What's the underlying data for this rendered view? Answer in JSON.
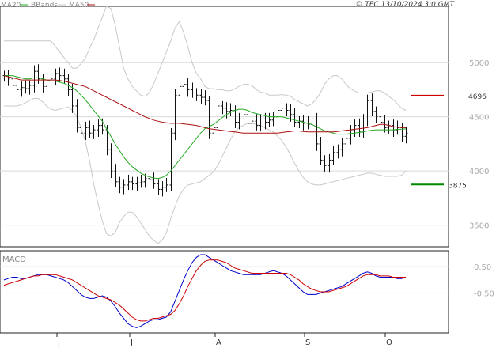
{
  "legend": [
    {
      "label": "MA20",
      "color": "#22aa22"
    },
    {
      "label": "BBands",
      "color": "#c8c8c8"
    },
    {
      "label": "MA50",
      "color": "#aa1111"
    }
  ],
  "copyright": "© TEC 13/10/2024 3:0 GMT",
  "macd_title": "MACD",
  "chart_data": [
    {
      "type": "line",
      "subtype": "bar-ohlc",
      "x_tick_labels": [
        "J",
        "J",
        "A",
        "S",
        "O"
      ],
      "y_tick_labels": [
        "5000",
        "4500",
        "4000",
        "3500"
      ],
      "ylim": [
        3300,
        5520
      ],
      "grid": true,
      "levels": [
        {
          "value": 4696,
          "label": "4696",
          "color": "#cc0000"
        },
        {
          "value": 3875,
          "label": "3875",
          "color": "#008800"
        }
      ],
      "price": [
        4880,
        4850,
        4790,
        4750,
        4770,
        4760,
        4790,
        4920,
        4850,
        4780,
        4830,
        4850,
        4900,
        4880,
        4850,
        4750,
        4600,
        4400,
        4350,
        4400,
        4350,
        4380,
        4420,
        4380,
        4200,
        4000,
        3900,
        3850,
        3870,
        3900,
        3880,
        3890,
        3900,
        3930,
        3920,
        3880,
        3830,
        3850,
        3870,
        4350,
        4700,
        4780,
        4800,
        4750,
        4720,
        4700,
        4680,
        4650,
        4350,
        4400,
        4600,
        4580,
        4550,
        4560,
        4450,
        4480,
        4520,
        4440,
        4460,
        4420,
        4480,
        4450,
        4470,
        4500,
        4560,
        4580,
        4560,
        4520,
        4450,
        4460,
        4440,
        4430,
        4480,
        4250,
        4100,
        4050,
        4100,
        4170,
        4200,
        4250,
        4300,
        4380,
        4420,
        4360,
        4480,
        4650,
        4550,
        4500,
        4450,
        4400,
        4420,
        4380,
        4400,
        4320,
        4350
      ],
      "series": [
        {
          "name": "MA20",
          "color": "#22aa22",
          "values": [
            4880,
            4880,
            4880,
            4870,
            4860,
            4850,
            4850,
            4860,
            4860,
            4850,
            4840,
            4830,
            4830,
            4820,
            4810,
            4790,
            4770,
            4740,
            4700,
            4660,
            4610,
            4560,
            4510,
            4460,
            4390,
            4320,
            4250,
            4190,
            4130,
            4080,
            4040,
            4010,
            3980,
            3960,
            3945,
            3935,
            3930,
            3940,
            3960,
            4000,
            4050,
            4100,
            4150,
            4200,
            4250,
            4300,
            4350,
            4390,
            4410,
            4430,
            4460,
            4490,
            4520,
            4540,
            4560,
            4570,
            4570,
            4560,
            4540,
            4530,
            4520,
            4510,
            4500,
            4500,
            4500,
            4500,
            4490,
            4480,
            4470,
            4460,
            4450,
            4440,
            4430,
            4410,
            4390,
            4370,
            4360,
            4350,
            4340,
            4340,
            4340,
            4345,
            4350,
            4355,
            4360,
            4370,
            4375,
            4380,
            4380,
            4380,
            4380,
            4380,
            4385,
            4385,
            4390
          ]
        },
        {
          "name": "MA50",
          "color": "#aa1111",
          "values": [
            4880,
            4870,
            4860,
            4850,
            4840,
            4840,
            4840,
            4840,
            4840,
            4840,
            4840,
            4840,
            4840,
            4835,
            4830,
            4820,
            4810,
            4800,
            4790,
            4780,
            4760,
            4740,
            4720,
            4700,
            4680,
            4660,
            4640,
            4620,
            4600,
            4580,
            4560,
            4540,
            4520,
            4500,
            4485,
            4470,
            4460,
            4450,
            4445,
            4440,
            4440,
            4440,
            4435,
            4430,
            4425,
            4420,
            4410,
            4400,
            4390,
            4385,
            4380,
            4375,
            4370,
            4365,
            4360,
            4355,
            4350,
            4350,
            4350,
            4350,
            4350,
            4350,
            4350,
            4350,
            4350,
            4355,
            4360,
            4365,
            4370,
            4370,
            4365,
            4360,
            4360,
            4360,
            4360,
            4360,
            4360,
            4360,
            4365,
            4370,
            4375,
            4380,
            4385,
            4390,
            4395,
            4400,
            4410,
            4420,
            4430,
            4430,
            4420,
            4410,
            4405,
            4400,
            4400
          ]
        },
        {
          "name": "BBands upper",
          "color": "#c8c8c8",
          "values": [
            5200,
            5200,
            5200,
            5200,
            5200,
            5200,
            5200,
            5200,
            5200,
            5200,
            5200,
            5200,
            5150,
            5100,
            5050,
            5000,
            4950,
            4950,
            4990,
            5040,
            5130,
            5210,
            5320,
            5420,
            5520,
            5500,
            5350,
            5150,
            4950,
            4850,
            4780,
            4740,
            4700,
            4690,
            4720,
            4800,
            4900,
            5000,
            5100,
            5200,
            5320,
            5380,
            5280,
            5150,
            5000,
            4900,
            4850,
            4780,
            4760,
            4760,
            4750,
            4750,
            4740,
            4740,
            4760,
            4780,
            4800,
            4800,
            4790,
            4750,
            4730,
            4720,
            4700,
            4700,
            4700,
            4705,
            4700,
            4690,
            4660,
            4640,
            4620,
            4600,
            4620,
            4660,
            4720,
            4800,
            4850,
            4880,
            4880,
            4850,
            4800,
            4760,
            4740,
            4720,
            4720,
            4720,
            4730,
            4740,
            4740,
            4720,
            4690,
            4660,
            4620,
            4580,
            4560
          ]
        },
        {
          "name": "BBands lower",
          "color": "#c8c8c8",
          "values": [
            4600,
            4600,
            4600,
            4600,
            4610,
            4630,
            4650,
            4670,
            4670,
            4640,
            4600,
            4570,
            4560,
            4570,
            4580,
            4590,
            4560,
            4500,
            4400,
            4280,
            4100,
            3880,
            3700,
            3540,
            3420,
            3400,
            3430,
            3520,
            3580,
            3620,
            3620,
            3580,
            3520,
            3460,
            3400,
            3360,
            3330,
            3360,
            3430,
            3560,
            3670,
            3770,
            3830,
            3870,
            3880,
            3890,
            3900,
            3930,
            3960,
            3990,
            4050,
            4130,
            4210,
            4290,
            4360,
            4400,
            4420,
            4440,
            4440,
            4430,
            4420,
            4400,
            4380,
            4360,
            4320,
            4280,
            4220,
            4150,
            4070,
            4000,
            3940,
            3900,
            3880,
            3870,
            3870,
            3880,
            3890,
            3900,
            3910,
            3920,
            3930,
            3940,
            3950,
            3960,
            3970,
            3980,
            3980,
            3970,
            3960,
            3950,
            3950,
            3950,
            3950,
            3960,
            4000
          ]
        }
      ]
    },
    {
      "type": "line",
      "title": "MACD",
      "y_tick_labels": [
        "0.50",
        "-0.50"
      ],
      "ylim": [
        -2.0,
        1.1
      ],
      "series": [
        {
          "name": "MACD",
          "color": "#0000cc",
          "values": [
            0.0,
            0.05,
            0.1,
            0.1,
            0.05,
            0.05,
            0.1,
            0.15,
            0.2,
            0.2,
            0.2,
            0.15,
            0.1,
            0.05,
            0.0,
            -0.1,
            -0.25,
            -0.4,
            -0.55,
            -0.65,
            -0.7,
            -0.7,
            -0.65,
            -0.6,
            -0.65,
            -0.8,
            -1.0,
            -1.25,
            -1.45,
            -1.65,
            -1.75,
            -1.8,
            -1.75,
            -1.65,
            -1.55,
            -1.5,
            -1.5,
            -1.45,
            -1.4,
            -1.2,
            -0.8,
            -0.4,
            0.0,
            0.35,
            0.65,
            0.85,
            0.95,
            0.95,
            0.85,
            0.75,
            0.65,
            0.55,
            0.45,
            0.35,
            0.3,
            0.25,
            0.2,
            0.2,
            0.2,
            0.2,
            0.2,
            0.25,
            0.3,
            0.35,
            0.3,
            0.25,
            0.15,
            0.0,
            -0.15,
            -0.3,
            -0.45,
            -0.55,
            -0.55,
            -0.55,
            -0.5,
            -0.45,
            -0.4,
            -0.35,
            -0.3,
            -0.25,
            -0.15,
            -0.05,
            0.05,
            0.15,
            0.25,
            0.3,
            0.25,
            0.15,
            0.1,
            0.1,
            0.1,
            0.1,
            0.05,
            0.05,
            0.1
          ]
        },
        {
          "name": "Signal",
          "color": "#cc0000",
          "values": [
            -0.2,
            -0.15,
            -0.1,
            -0.05,
            0.0,
            0.05,
            0.1,
            0.15,
            0.15,
            0.2,
            0.2,
            0.2,
            0.2,
            0.15,
            0.1,
            0.05,
            0.0,
            -0.1,
            -0.2,
            -0.3,
            -0.4,
            -0.5,
            -0.6,
            -0.65,
            -0.7,
            -0.75,
            -0.85,
            -0.95,
            -1.1,
            -1.25,
            -1.4,
            -1.5,
            -1.55,
            -1.55,
            -1.5,
            -1.45,
            -1.45,
            -1.4,
            -1.35,
            -1.3,
            -1.15,
            -0.9,
            -0.6,
            -0.25,
            0.05,
            0.35,
            0.55,
            0.7,
            0.75,
            0.75,
            0.75,
            0.7,
            0.65,
            0.55,
            0.45,
            0.4,
            0.35,
            0.3,
            0.25,
            0.25,
            0.25,
            0.25,
            0.25,
            0.25,
            0.25,
            0.25,
            0.25,
            0.2,
            0.1,
            0.0,
            -0.15,
            -0.25,
            -0.35,
            -0.4,
            -0.45,
            -0.45,
            -0.45,
            -0.4,
            -0.35,
            -0.3,
            -0.25,
            -0.15,
            -0.05,
            0.05,
            0.15,
            0.2,
            0.2,
            0.2,
            0.15,
            0.15,
            0.15,
            0.1,
            0.1,
            0.1,
            0.1
          ]
        }
      ]
    }
  ]
}
